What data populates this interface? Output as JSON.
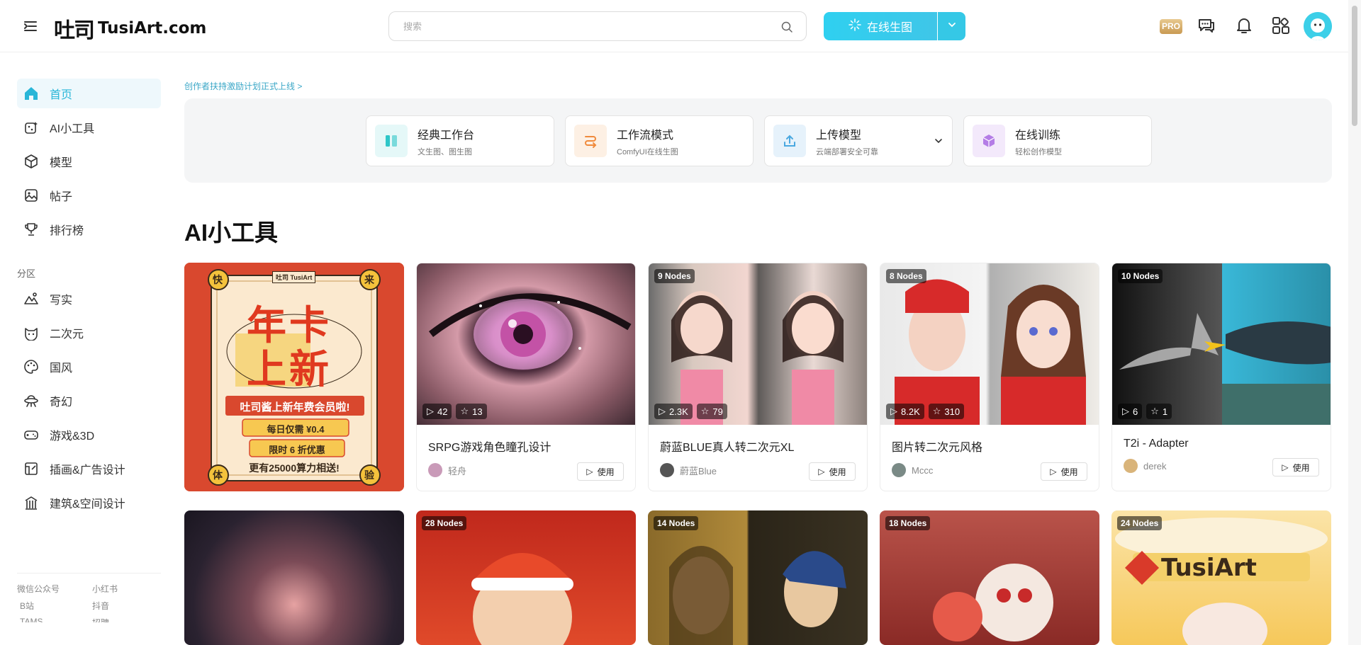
{
  "header": {
    "logo_mark": "吐司",
    "logo_text": "TusiArt.com",
    "search_placeholder": "搜索",
    "generate_label": "在线生图",
    "pro_label": "PRO"
  },
  "sidebar": {
    "items": [
      {
        "label": "首页",
        "icon": "home-icon"
      },
      {
        "label": "AI小工具",
        "icon": "ai-tool-icon"
      },
      {
        "label": "模型",
        "icon": "cube-icon"
      },
      {
        "label": "帖子",
        "icon": "image-icon"
      },
      {
        "label": "排行榜",
        "icon": "trophy-icon"
      }
    ],
    "section_label": "分区",
    "categories": [
      {
        "label": "写实",
        "icon": "mountain-icon"
      },
      {
        "label": "二次元",
        "icon": "cat-face-icon"
      },
      {
        "label": "国风",
        "icon": "palette-icon"
      },
      {
        "label": "奇幻",
        "icon": "ufo-icon"
      },
      {
        "label": "游戏&3D",
        "icon": "gamepad-icon"
      },
      {
        "label": "插画&广告设计",
        "icon": "illustration-icon"
      },
      {
        "label": "建筑&空间设计",
        "icon": "building-icon"
      }
    ],
    "footer_links": [
      "微信公众号",
      "小红书",
      "B站",
      "抖音",
      "TAMS",
      "招聘"
    ]
  },
  "main": {
    "announcement": "创作者扶持激励计划正式上线 >",
    "quick_cards": [
      {
        "title": "经典工作台",
        "subtitle": "文生图、图生图",
        "color": "#2fc6c8"
      },
      {
        "title": "工作流模式",
        "subtitle": "ComfyUI在线生图",
        "color": "#f08a3c"
      },
      {
        "title": "上传模型",
        "subtitle": "云端部署安全可靠",
        "color": "#4aa8e0"
      },
      {
        "title": "在线训练",
        "subtitle": "轻松创作模型",
        "color": "#a66ad8"
      }
    ],
    "section_title": "AI小工具",
    "use_label": "使用",
    "promo": {
      "corner_tl": "快",
      "corner_tr": "来",
      "corner_bl": "体",
      "corner_br": "验",
      "logo": "吐司 TusiArt",
      "line1": "年卡",
      "line2": "上新",
      "headline": "吐司酱上新年费会员啦!",
      "price": "每日仅需 ¥0.4",
      "discount": "限时 6 折优惠",
      "bonus": "更有25000算力相送!"
    },
    "cards_row1": [
      {
        "nodes": "",
        "plays": "42",
        "stars": "13",
        "title": "SRPG游戏角色瞳孔设计",
        "author": "轻舟"
      },
      {
        "nodes": "9 Nodes",
        "plays": "2.3K",
        "stars": "79",
        "title": "蔚蓝BLUE真人转二次元XL",
        "author": "蔚蓝Blue"
      },
      {
        "nodes": "8 Nodes",
        "plays": "8.2K",
        "stars": "310",
        "title": "图片转二次元风格",
        "author": "Mccc"
      },
      {
        "nodes": "10 Nodes",
        "plays": "6",
        "stars": "1",
        "title": "T2i - Adapter",
        "author": "derek"
      }
    ],
    "cards_row2": [
      {
        "nodes": ""
      },
      {
        "nodes": "28 Nodes"
      },
      {
        "nodes": "14 Nodes"
      },
      {
        "nodes": "18 Nodes"
      },
      {
        "nodes": "24 Nodes"
      }
    ]
  }
}
